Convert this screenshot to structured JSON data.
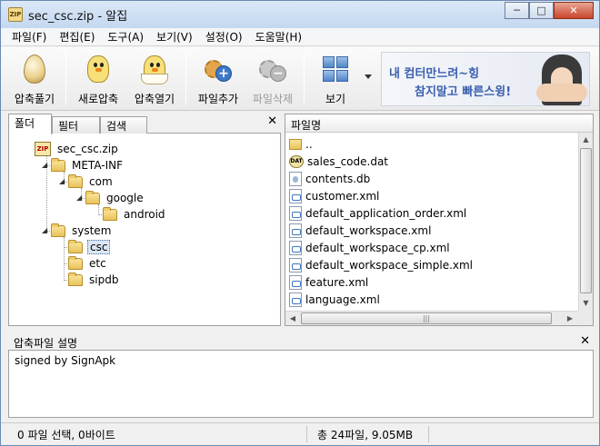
{
  "window": {
    "title": "sec_csc.zip - 알집",
    "app_icon_text": "ZIP",
    "minimize_glyph": "─",
    "maximize_glyph": "□",
    "close_glyph": "✕"
  },
  "menubar": [
    "파일(F)",
    "편집(E)",
    "도구(A)",
    "보기(V)",
    "설정(O)",
    "도움말(H)"
  ],
  "toolbar": {
    "unzip_label": "압축풀기",
    "new_label": "새로압축",
    "open_label": "압축열기",
    "add_label": "파일추가",
    "delete_label": "파일삭제",
    "view_label": "보기",
    "add_glyph": "+",
    "delete_glyph": "−"
  },
  "banner": {
    "line1": "내 컴터만느려~힝",
    "line2": "참지말고 빠른스윙!"
  },
  "left_pane": {
    "tabs": [
      "폴더",
      "필터",
      "검색"
    ],
    "close_glyph": "✕",
    "tree": [
      {
        "label": "sec_csc.zip",
        "expander": "",
        "icon": "zip"
      },
      {
        "label": "META-INF",
        "expander": "◢",
        "icon": "folder"
      },
      {
        "label": "com",
        "expander": "◢",
        "icon": "folder"
      },
      {
        "label": "google",
        "expander": "◢",
        "icon": "folder"
      },
      {
        "label": "android",
        "expander": "",
        "icon": "folder"
      },
      {
        "label": "system",
        "expander": "◢",
        "icon": "folder"
      },
      {
        "label": "csc",
        "expander": "",
        "icon": "folder",
        "selected": true
      },
      {
        "label": "etc",
        "expander": "",
        "icon": "folder"
      },
      {
        "label": "sipdb",
        "expander": "",
        "icon": "folder"
      }
    ]
  },
  "right_pane": {
    "column_header": "파일명",
    "files": [
      {
        "name": "..",
        "icon": "folder"
      },
      {
        "name": "sales_code.dat",
        "icon": "dat"
      },
      {
        "name": "contents.db",
        "icon": "db"
      },
      {
        "name": "customer.xml",
        "icon": "xml"
      },
      {
        "name": "default_application_order.xml",
        "icon": "xml"
      },
      {
        "name": "default_workspace.xml",
        "icon": "xml"
      },
      {
        "name": "default_workspace_cp.xml",
        "icon": "xml"
      },
      {
        "name": "default_workspace_simple.xml",
        "icon": "xml"
      },
      {
        "name": "feature.xml",
        "icon": "xml"
      },
      {
        "name": "language.xml",
        "icon": "xml"
      }
    ],
    "scroll_up": "▲",
    "scroll_down": "▼",
    "scroll_left": "◀",
    "scroll_right": "▶",
    "thumb_grip": "|||"
  },
  "description": {
    "header": "압축파일 설명",
    "close_glyph": "✕",
    "text": "signed by SignApk"
  },
  "statusbar": {
    "selection": "0 파일 선택,  0바이트",
    "total": "총 24파일,  9.05MB"
  },
  "colors": {
    "title_gradient_top": "#dbe8f7",
    "close_button": "#c9462c",
    "banner_text": "#3b5fb0",
    "selection_bg": "#dbe6f5"
  }
}
